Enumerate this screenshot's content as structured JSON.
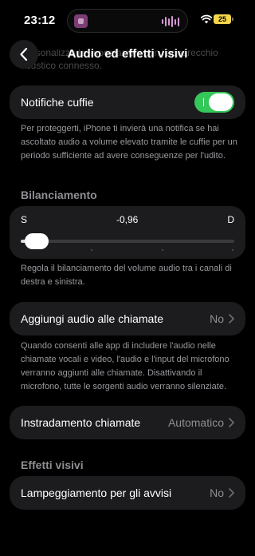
{
  "status_bar": {
    "time": "23:12",
    "battery": "25"
  },
  "header": {
    "title": "Audio ed effetti visivi",
    "ghost_text": "Personalizza le impostazioni con l'apparecchio acustico connesso."
  },
  "headphone_notifications": {
    "label": "Notifiche cuffie",
    "enabled": true,
    "description": "Per proteggerti, iPhone ti invierà una notifica se hai ascoltato audio a volume elevato tramite le cuffie per un periodo sufficiente ad avere conseguenze per l'udito."
  },
  "balance": {
    "section_title": "Bilanciamento",
    "left_label": "S",
    "right_label": "D",
    "value_text": "-0,96",
    "value": -0.96,
    "description": "Regola il bilanciamento del volume audio tra i canali di destra e sinistra."
  },
  "call_audio": {
    "label": "Aggiungi audio alle chiamate",
    "value": "No",
    "description": "Quando consenti alle app di includere l'audio nelle chiamate vocali e video, l'audio e l'input del microfono verranno aggiunti alle chiamate. Disattivando il microfono, tutte le sorgenti audio verranno silenziate."
  },
  "call_routing": {
    "label": "Instradamento chiamate",
    "value": "Automatico"
  },
  "visual_effects": {
    "section_title": "Effetti visivi",
    "flash": {
      "label": "Lampeggiamento per gli avvisi",
      "value": "No"
    }
  }
}
